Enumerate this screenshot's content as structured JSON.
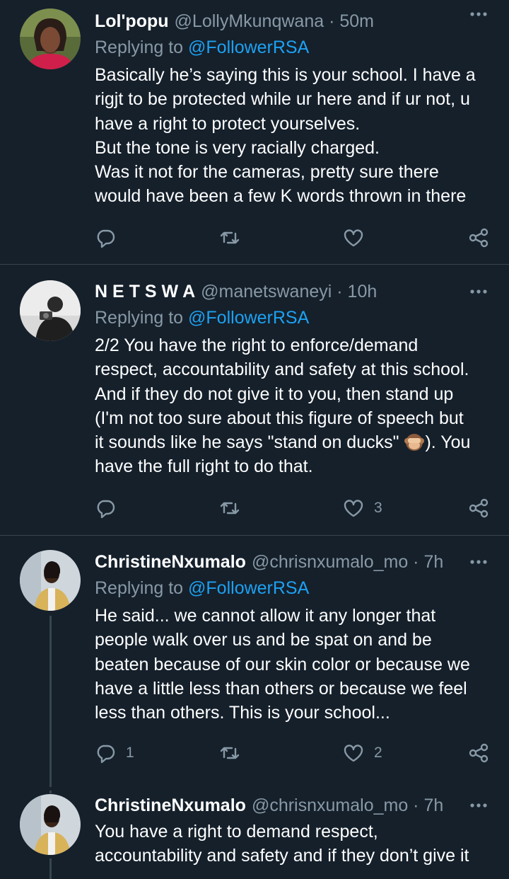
{
  "tweets": [
    {
      "name": "Lol'popu",
      "handle": "@LollyMkunqwana · 50m",
      "reply_prefix": "Replying to",
      "reply_target": "@FollowerRSA",
      "lines": [
        "Basically he’s saying this is your school. I have a",
        "rigjt to be protected while ur here and if ur not, u",
        "have a right to protect yourselves.",
        "But the tone is very racially charged.",
        "Was it not for the cameras, pretty sure there",
        "would have been a few K words thrown in there"
      ],
      "reply_count": "",
      "retweet_count": "",
      "like_count": ""
    },
    {
      "name": "N E T S W A",
      "handle": "@manetswaneyi · 10h",
      "reply_prefix": "Replying to",
      "reply_target": "@FollowerRSA",
      "lines": [
        "2/2 You have the right to enforce/demand",
        "respect, accountability and safety at this school.",
        "And if they do not give it to you, then stand up",
        "(I'm not too sure about this figure of speech but",
        "it sounds like he says \"stand on ducks\"",
        "). You",
        "have the full right to do that."
      ],
      "reply_count": "",
      "retweet_count": "",
      "like_count": "3"
    },
    {
      "name": "ChristineNxumalo",
      "handle": "@chrisnxumalo_mo · 7h",
      "reply_prefix": "Replying to",
      "reply_target": "@FollowerRSA",
      "lines": [
        "He said... we cannot allow it any longer that",
        "people walk over us and be spat on and be",
        "beaten because of our skin color or because we",
        "have a little less than others or because we feel",
        "less than others. This is your school..."
      ],
      "reply_count": "1",
      "retweet_count": "",
      "like_count": "2"
    },
    {
      "name": "ChristineNxumalo",
      "handle": "@chrisnxumalo_mo · 7h",
      "lines": [
        "You have a right to demand respect,",
        "accountability and safety and if they don’t give it"
      ]
    }
  ],
  "emoji": "see-no-evil-monkey",
  "colors": {
    "background": "#15202b",
    "divider": "#38444d",
    "secondary_text": "#8899a6",
    "link": "#1da1f2"
  }
}
